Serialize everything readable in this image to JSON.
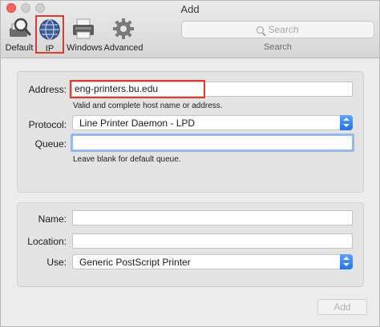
{
  "window": {
    "title": "Add"
  },
  "toolbar": {
    "items": [
      {
        "label": "Default",
        "icon": "default-printer-icon"
      },
      {
        "label": "IP",
        "icon": "globe-icon"
      },
      {
        "label": "Windows",
        "icon": "windows-printer-icon"
      },
      {
        "label": "Advanced",
        "icon": "gear-icon"
      }
    ],
    "selected": "IP",
    "search": {
      "placeholder": "Search",
      "caption": "Search"
    }
  },
  "ip_form": {
    "address": {
      "label": "Address:",
      "value": "eng-printers.bu.edu",
      "help": "Valid and complete host name or address."
    },
    "protocol": {
      "label": "Protocol:",
      "value": "Line Printer Daemon - LPD"
    },
    "queue": {
      "label": "Queue:",
      "value": "",
      "help": "Leave blank for default queue."
    }
  },
  "printer_info": {
    "name": {
      "label": "Name:",
      "value": ""
    },
    "location": {
      "label": "Location:",
      "value": ""
    },
    "use": {
      "label": "Use:",
      "value": "Generic PostScript Printer"
    }
  },
  "footer": {
    "add_label": "Add",
    "add_enabled": false
  },
  "colors": {
    "highlight": "#e23a2a",
    "accent": "#1f72f0",
    "focus_ring": "#8fb9f2"
  }
}
